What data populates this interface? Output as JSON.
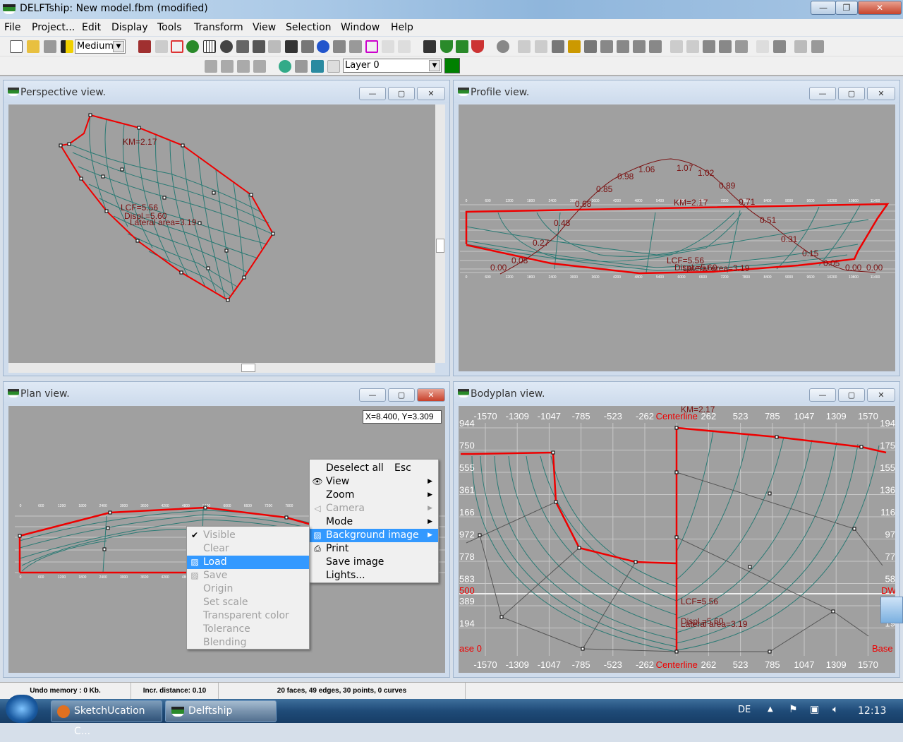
{
  "window": {
    "title": "DELFTship: New model.fbm (modified)",
    "minimize": "—",
    "maximize": "❐",
    "close": "✕"
  },
  "menu": [
    "File",
    "Project...",
    "Edit",
    "Display",
    "Tools",
    "Transform",
    "View",
    "Selection",
    "Window",
    "Help"
  ],
  "toolbar": {
    "precision": "Medium",
    "layer": "Layer 0",
    "layer_color": "#008000"
  },
  "views": {
    "perspective": {
      "title": "Perspective view.",
      "labels": {
        "km": "KM=2.17",
        "lcf": "LCF=5.56",
        "displ": "Displ.=5.60",
        "lateral": "Lateral area=3.19"
      }
    },
    "profile": {
      "title": "Profile view.",
      "labels": {
        "km": "KM=2.17",
        "lcf": "LCF=5.56",
        "displ": "Displ.=5.60",
        "lateral": "Lateral area=3.19"
      },
      "stability_values": [
        "0.00",
        "0.08",
        "0.27",
        "0.48",
        "0.68",
        "0.85",
        "0.98",
        "1.06",
        "1.07",
        "1.02",
        "0.89",
        "0.71",
        "0.51",
        "0.31",
        "0.15",
        "0.05",
        "0.00",
        "0.00"
      ],
      "ruler": [
        "0",
        "600",
        "1200",
        "1800",
        "2400",
        "3000",
        "3600",
        "4200",
        "4800",
        "5400",
        "6000",
        "6600",
        "7200",
        "7800",
        "8400",
        "9000",
        "9600",
        "10200",
        "10800",
        "11400"
      ]
    },
    "plan": {
      "title": "Plan view.",
      "coords": "X=8.400,  Y=3.309",
      "ruler": [
        "0",
        "600",
        "1200",
        "1800",
        "2400",
        "3000",
        "3600",
        "4200",
        "4800",
        "5400",
        "6000",
        "6600",
        "7200",
        "7800"
      ]
    },
    "bodyplan": {
      "title": "Bodyplan view.",
      "km": "KM=2.17",
      "lcf": "LCF=5.56",
      "displ": "Displ.=5.60",
      "lateral": "Lateral area=3.19",
      "x_ticks": [
        "-1570",
        "-1309",
        "-1047",
        "-785",
        "-523",
        "-262",
        "Centerline",
        "262",
        "523",
        "785",
        "1047",
        "1309",
        "1570"
      ],
      "left_ticks": [
        "944",
        "750",
        "555",
        "361",
        "166",
        "972",
        "778",
        "583",
        "389",
        "194"
      ],
      "right_ticks": [
        "194",
        "175",
        "155",
        "136",
        "116",
        "97",
        "77",
        "58",
        "19"
      ],
      "base_left": "ase 0",
      "base_right": "Base",
      "dwl_left": "500",
      "dwl_right": "DW"
    }
  },
  "context_menu": {
    "items": [
      {
        "label": "Deselect all",
        "shortcut": "Esc"
      },
      {
        "label": "View",
        "icon": "eye-icon",
        "submenu": true
      },
      {
        "label": "Zoom",
        "submenu": true
      },
      {
        "label": "Camera",
        "icon": "camera-icon",
        "submenu": true,
        "disabled": true
      },
      {
        "label": "Mode",
        "submenu": true
      },
      {
        "label": "Background image",
        "icon": "background-image-icon",
        "submenu": true,
        "highlighted": true
      },
      {
        "label": "Print",
        "icon": "printer-icon"
      },
      {
        "label": "Save image"
      },
      {
        "label": "Lights..."
      }
    ]
  },
  "background_submenu": {
    "items": [
      {
        "label": "Visible",
        "checked": true,
        "disabled": true
      },
      {
        "label": "Clear",
        "disabled": true
      },
      {
        "label": "Load",
        "highlighted": true
      },
      {
        "label": "Save",
        "disabled": true
      },
      {
        "label": "Origin",
        "disabled": true
      },
      {
        "label": "Set scale",
        "disabled": true
      },
      {
        "label": "Transparent color",
        "disabled": true
      },
      {
        "label": "Tolerance",
        "disabled": true
      },
      {
        "label": "Blending",
        "disabled": true
      }
    ]
  },
  "status": {
    "undo": "Undo memory : 0 Kb.",
    "incr": "Incr. distance: 0.10",
    "info": "20 faces, 49 edges, 30 points, 0 curves"
  },
  "taskbar": {
    "tasks": [
      "SketchUcation C...",
      "Delftship"
    ],
    "lang": "DE",
    "clock": "12:13"
  }
}
